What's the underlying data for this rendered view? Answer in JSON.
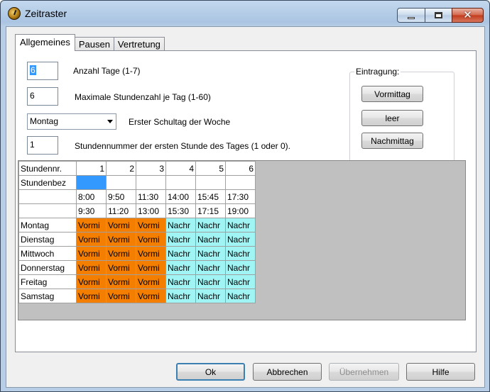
{
  "window": {
    "title": "Zeitraster"
  },
  "tabs": [
    {
      "label": "Allgemeines",
      "active": true
    },
    {
      "label": "Pausen",
      "active": false
    },
    {
      "label": "Vertretung",
      "active": false
    }
  ],
  "fields": {
    "days_value": "6",
    "days_label": "Anzahl Tage (1-7)",
    "max_hours_value": "6",
    "max_hours_label": "Maximale Stundenzahl je Tag (1-60)",
    "first_day_value": "Montag",
    "first_day_label": "Erster Schultag der Woche",
    "first_hour_value": "1",
    "first_hour_label": "Stundennummer der ersten Stunde des Tages (1 oder 0)."
  },
  "entry_group": {
    "title": "Eintragung:",
    "morning": "Vormittag",
    "empty": "leer",
    "afternoon": "Nachmittag"
  },
  "grid": {
    "corner": "Stundennr.",
    "label_row": "Stundenbez",
    "columns": [
      "1",
      "2",
      "3",
      "4",
      "5",
      "6"
    ],
    "start_times": [
      "8:00",
      "9:50",
      "11:30",
      "14:00",
      "15:45",
      "17:30"
    ],
    "end_times": [
      "9:30",
      "11:20",
      "13:00",
      "15:30",
      "17:15",
      "19:00"
    ],
    "rows": [
      {
        "day": "Montag",
        "cells": [
          "Vormi",
          "Vormi",
          "Vormi",
          "Nachr",
          "Nachr",
          "Nachr"
        ]
      },
      {
        "day": "Dienstag",
        "cells": [
          "Vormi",
          "Vormi",
          "Vormi",
          "Nachr",
          "Nachr",
          "Nachr"
        ]
      },
      {
        "day": "Mittwoch",
        "cells": [
          "Vormi",
          "Vormi",
          "Vormi",
          "Nachr",
          "Nachr",
          "Nachr"
        ]
      },
      {
        "day": "Donnerstag",
        "cells": [
          "Vormi",
          "Vormi",
          "Vormi",
          "Nachr",
          "Nachr",
          "Nachr"
        ]
      },
      {
        "day": "Freitag",
        "cells": [
          "Vormi",
          "Vormi",
          "Vormi",
          "Nachr",
          "Nachr",
          "Nachr"
        ]
      },
      {
        "day": "Samstag",
        "cells": [
          "Vormi",
          "Vormi",
          "Vormi",
          "Nachr",
          "Nachr",
          "Nachr"
        ]
      }
    ]
  },
  "colors": {
    "morning": "#f47e00",
    "afternoon": "#a0f4f4",
    "selection": "#3399ff"
  },
  "buttons": {
    "ok": "Ok",
    "cancel": "Abbrechen",
    "apply": "Übernehmen",
    "help": "Hilfe"
  }
}
